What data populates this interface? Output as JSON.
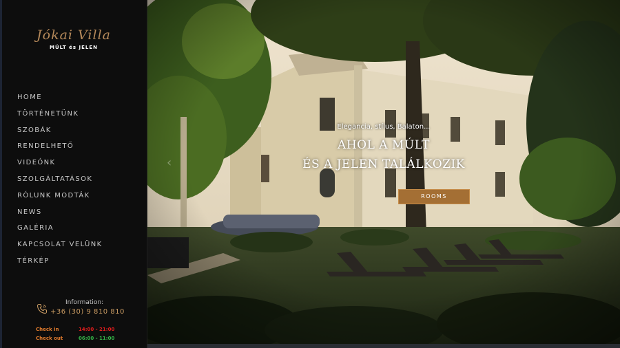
{
  "logo": {
    "script_text": "Jókai Villa",
    "subtitle": "MÚLT és JELEN"
  },
  "nav": {
    "items": [
      {
        "label": "HOME"
      },
      {
        "label": "TÖRTÉNETÜNK"
      },
      {
        "label": "SZOBÁK"
      },
      {
        "label": "RENDELHETŐ"
      },
      {
        "label": "VIDEÓNK"
      },
      {
        "label": "SZOLGÁLTATÁSOK"
      },
      {
        "label": "RÓLUNK MODTÁK"
      },
      {
        "label": "NEWS"
      },
      {
        "label": "GALÉRIA"
      },
      {
        "label": "KAPCSOLAT VELÜNK"
      },
      {
        "label": "TÉRKÉP"
      }
    ]
  },
  "info": {
    "label": "Information:",
    "phone": "+36 (30) 9 810 810",
    "check_in_label": "Check in",
    "check_in_time": "14:00 - 21:00",
    "check_out_label": "Check out",
    "check_out_time": "06:00 - 11:00"
  },
  "hero": {
    "tagline": "Elegancia, stílus, Balaton...",
    "title_line1": "AHOL A MÚLT",
    "title_line2": "ÉS A JELEN TALÁLKOZIK",
    "button_label": "ROOMS",
    "prev_arrow": "‹"
  },
  "colors": {
    "sidebar_bg": "#0d0d0d",
    "accent_gold": "#b5895a",
    "button_bg": "#a46f34",
    "check_label": "#e07b2d",
    "check_in_time": "#e11d1d",
    "check_out_time": "#35b84a"
  },
  "icons": {
    "phone": "phone-icon"
  }
}
